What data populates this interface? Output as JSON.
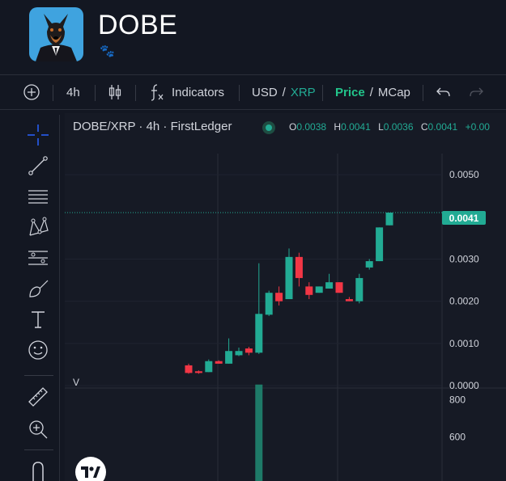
{
  "header": {
    "token_name": "DOBE",
    "paw_glyph": "🐾",
    "avatar_icon": "doberman-avatar-icon"
  },
  "toolbar": {
    "interval": "4h",
    "indicators_label": "Indicators",
    "currency_usd": "USD",
    "currency_sep": "/",
    "currency_xrp": "XRP",
    "mode_price": "Price",
    "mode_sep": "/",
    "mode_mcap": "MCap"
  },
  "legend": {
    "symbol": "DOBE/XRP · 4h · FirstLedger",
    "open_key": "O",
    "open": "0.0038",
    "high_key": "H",
    "high": "0.0041",
    "low_key": "L",
    "low": "0.0036",
    "close_key": "C",
    "close": "0.0041",
    "change": "+0.00"
  },
  "price_axis": {
    "labels": [
      "0.0050",
      "0.0030",
      "0.0020",
      "0.0010",
      "0.0000"
    ],
    "current_price": "0.0041"
  },
  "volume_axis": {
    "labels": [
      "800",
      "600"
    ],
    "pane_label": "V"
  },
  "colors": {
    "up": "#22ab94",
    "down": "#f23645",
    "background": "#161a25"
  },
  "chart_data": {
    "type": "candlestick",
    "ylim": [
      0,
      0.0055
    ],
    "candles": [
      {
        "o": 0.00048,
        "h": 0.00052,
        "l": 0.00028,
        "c": 0.0003
      },
      {
        "o": 0.00034,
        "h": 0.00036,
        "l": 0.00028,
        "c": 0.0003
      },
      {
        "o": 0.00032,
        "h": 0.00062,
        "l": 0.00032,
        "c": 0.00058
      },
      {
        "o": 0.00058,
        "h": 0.0006,
        "l": 0.00052,
        "c": 0.00052
      },
      {
        "o": 0.00052,
        "h": 0.00112,
        "l": 0.00052,
        "c": 0.00082
      },
      {
        "o": 0.00072,
        "h": 0.0009,
        "l": 0.0007,
        "c": 0.00082
      },
      {
        "o": 0.00088,
        "h": 0.00092,
        "l": 0.00072,
        "c": 0.00078
      },
      {
        "o": 0.00078,
        "h": 0.0029,
        "l": 0.00075,
        "c": 0.0017
      },
      {
        "o": 0.00168,
        "h": 0.00225,
        "l": 0.00165,
        "c": 0.0022
      },
      {
        "o": 0.0022,
        "h": 0.00235,
        "l": 0.0019,
        "c": 0.002
      },
      {
        "o": 0.00205,
        "h": 0.00325,
        "l": 0.00205,
        "c": 0.00305
      },
      {
        "o": 0.00305,
        "h": 0.00315,
        "l": 0.00235,
        "c": 0.00255
      },
      {
        "o": 0.00235,
        "h": 0.00245,
        "l": 0.00205,
        "c": 0.00215
      },
      {
        "o": 0.0022,
        "h": 0.00235,
        "l": 0.0022,
        "c": 0.00235
      },
      {
        "o": 0.0023,
        "h": 0.00265,
        "l": 0.0023,
        "c": 0.00245
      },
      {
        "o": 0.00245,
        "h": 0.00245,
        "l": 0.0022,
        "c": 0.0022
      },
      {
        "o": 0.00205,
        "h": 0.0021,
        "l": 0.002,
        "c": 0.002
      },
      {
        "o": 0.002,
        "h": 0.00265,
        "l": 0.00195,
        "c": 0.00255
      },
      {
        "o": 0.0028,
        "h": 0.003,
        "l": 0.00275,
        "c": 0.00295
      },
      {
        "o": 0.00295,
        "h": 0.00375,
        "l": 0.00295,
        "c": 0.00375
      },
      {
        "o": 0.0038,
        "h": 0.0041,
        "l": 0.0038,
        "c": 0.0041
      }
    ],
    "volume": [
      0,
      0,
      0,
      0,
      0,
      0,
      0,
      880,
      0,
      0,
      0,
      0,
      0,
      0,
      0,
      0,
      0,
      0,
      0,
      0,
      0
    ],
    "volume_ylim": [
      560,
      840
    ]
  }
}
